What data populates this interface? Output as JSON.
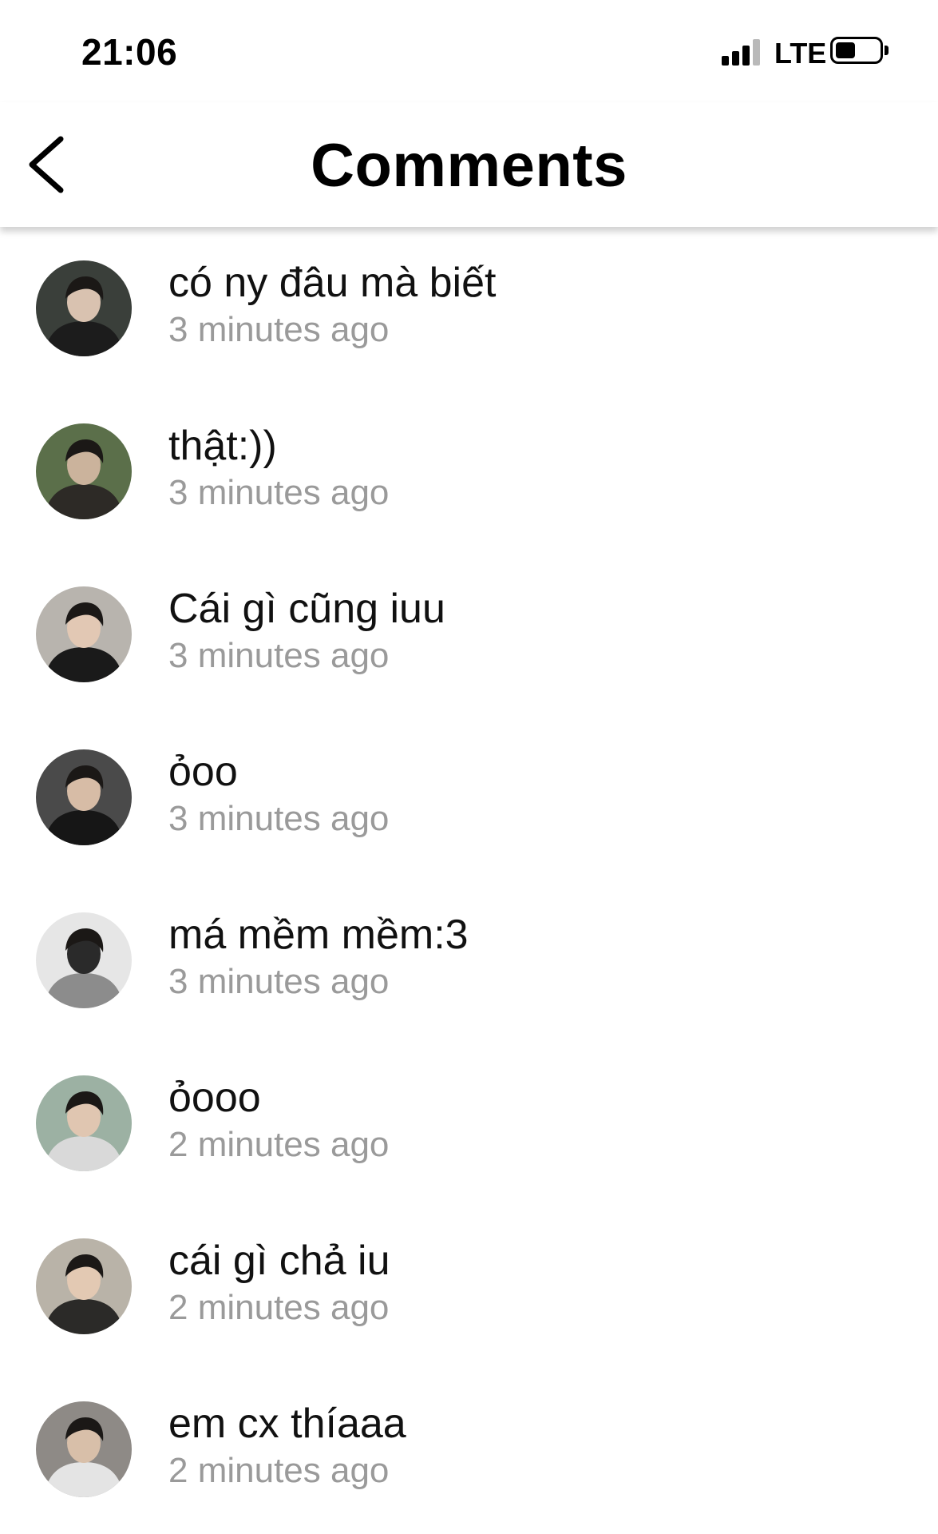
{
  "status_bar": {
    "time": "21:06",
    "network": "LTE",
    "signal_bars": 3,
    "signal_bars_total": 4,
    "battery_level": 0.45
  },
  "header": {
    "back_icon": "chevron-left-icon",
    "title": "Comments"
  },
  "comments": [
    {
      "text": "có ny đâu mà biết",
      "time": "3 minutes ago",
      "avatar_colors": [
        "#3a3f3a",
        "#1c1c1c",
        "#d9c2b0"
      ]
    },
    {
      "text": "thật:))",
      "time": "3 minutes ago",
      "avatar_colors": [
        "#5b6f4a",
        "#2d2a26",
        "#cbb39c"
      ]
    },
    {
      "text": "Cái gì cũng iuu",
      "time": "3 minutes ago",
      "avatar_colors": [
        "#b8b4ae",
        "#1a1a1a",
        "#e2c8b4"
      ]
    },
    {
      "text": "ỏoo",
      "time": "3 minutes ago",
      "avatar_colors": [
        "#4a4a4a",
        "#161616",
        "#d7bca6"
      ]
    },
    {
      "text": "má mềm mềm:3",
      "time": "3 minutes ago",
      "avatar_colors": [
        "#e6e6e6",
        "#8c8c8c",
        "#2a2a2a"
      ]
    },
    {
      "text": "ỏooo",
      "time": "2 minutes ago",
      "avatar_colors": [
        "#9cb1a3",
        "#d9d9d9",
        "#e0c6b1"
      ]
    },
    {
      "text": "cái gì chả iu",
      "time": "2 minutes ago",
      "avatar_colors": [
        "#b9b3a8",
        "#2b2a28",
        "#e3c9b3"
      ]
    },
    {
      "text": "em cx thíaaa",
      "time": "2 minutes ago",
      "avatar_colors": [
        "#8e8a86",
        "#e4e4e4",
        "#d8bfa9"
      ]
    }
  ]
}
